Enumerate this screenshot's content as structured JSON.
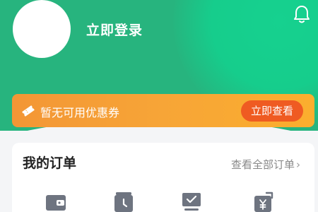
{
  "header": {
    "login_label": "立即登录"
  },
  "coupon": {
    "text": "暂无可用优惠券",
    "button_label": "立即查看"
  },
  "orders": {
    "title": "我的订单",
    "view_all_label": "查看全部订单",
    "icons": [
      "wallet-icon",
      "clock-icon",
      "monitor-check-icon",
      "refund-yen-icon"
    ]
  },
  "colors": {
    "header_green": "#27b47e",
    "coupon_orange": "#f7a537",
    "button_red_orange": "#ef5b22"
  }
}
